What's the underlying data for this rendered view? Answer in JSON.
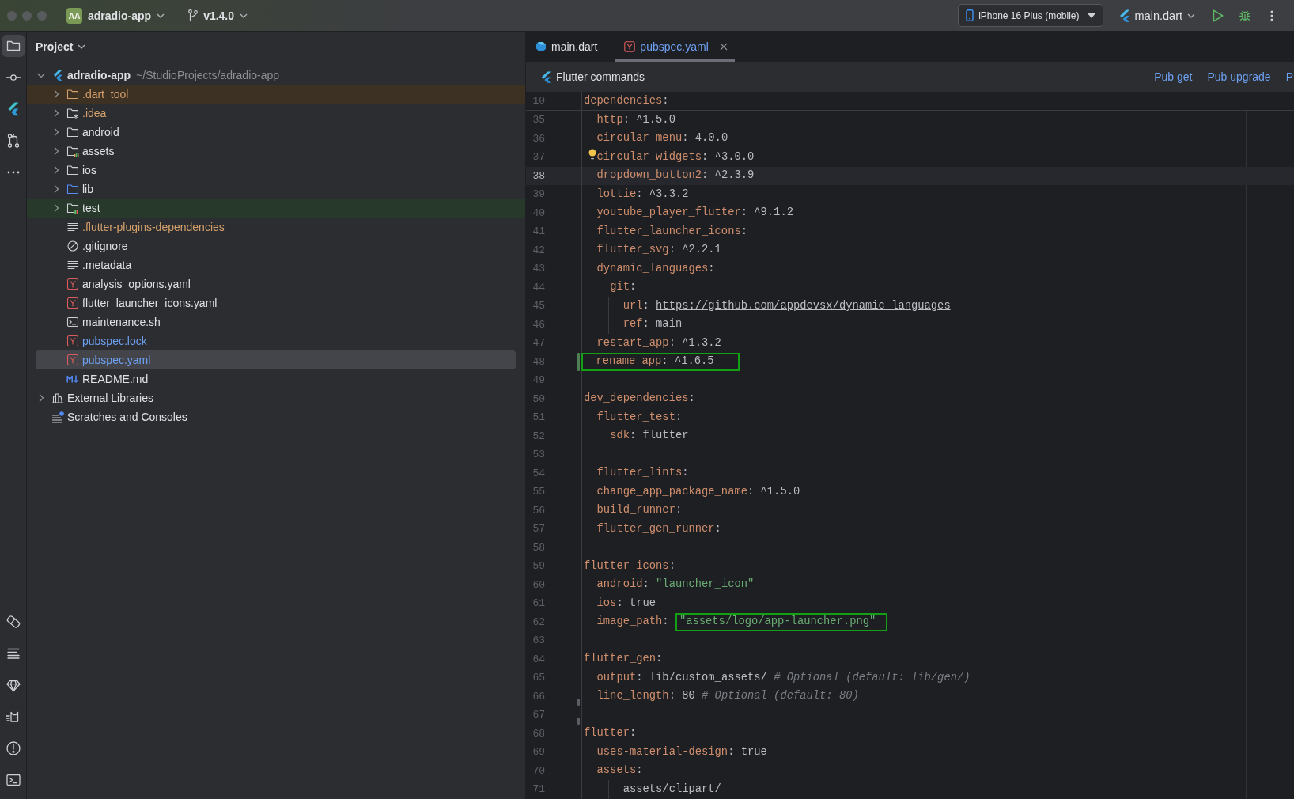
{
  "window": {
    "project_badge": "AA",
    "project": "adradio-app",
    "branch": "v1.4.0",
    "device": "iPhone 16 Plus (mobile)",
    "run_config": "main.dart"
  },
  "tool_strip": {
    "top": [
      {
        "kind": "project",
        "selected": true
      },
      {
        "kind": "commit",
        "selected": false
      },
      {
        "kind": "flutter",
        "selected": false
      },
      {
        "kind": "pull-requests",
        "selected": false
      },
      {
        "kind": "more",
        "selected": false
      }
    ],
    "bottom": [
      {
        "kind": "eraser",
        "selected": false
      },
      {
        "kind": "structure",
        "selected": false
      },
      {
        "kind": "gem",
        "selected": false
      },
      {
        "kind": "cat",
        "selected": false
      },
      {
        "kind": "problems",
        "selected": false
      },
      {
        "kind": "terminal",
        "selected": false
      }
    ]
  },
  "project_panel": {
    "title": "Project",
    "tree": [
      {
        "name": "adradio-app",
        "path": "~/StudioProjects/adradio-app",
        "kind": "project",
        "color": "#dfe1e5",
        "expanded": true,
        "selected": false,
        "children": [
          {
            "name": ".dart_tool",
            "kind": "excluded-folder",
            "color": "#d5a06b",
            "expanded": false,
            "selected": false
          },
          {
            "name": ".idea",
            "kind": "config-folder",
            "color": "#d5a06b",
            "expanded": false,
            "selected": false
          },
          {
            "name": "android",
            "kind": "folder",
            "color": "#dfe1e5",
            "expanded": false,
            "selected": false
          },
          {
            "name": "assets",
            "kind": "resource-folder",
            "color": "#dfe1e5",
            "expanded": false,
            "selected": false
          },
          {
            "name": "ios",
            "kind": "folder",
            "color": "#dfe1e5",
            "expanded": false,
            "selected": false
          },
          {
            "name": "lib",
            "kind": "source-folder",
            "color": "#dfe1e5",
            "expanded": false,
            "selected": false
          },
          {
            "name": "test",
            "kind": "test-folder",
            "color": "#dfe1e5",
            "expanded": false,
            "selected": false
          },
          {
            "name": ".flutter-plugins-dependencies",
            "kind": "text-file",
            "color": "#d5a06b",
            "selected": false
          },
          {
            "name": ".gitignore",
            "kind": "ignore-file",
            "color": "#dfe1e5",
            "selected": false
          },
          {
            "name": ".metadata",
            "kind": "text-file",
            "color": "#dfe1e5",
            "selected": false
          },
          {
            "name": "analysis_options.yaml",
            "kind": "yaml-file",
            "color": "#dfe1e5",
            "selected": false
          },
          {
            "name": "flutter_launcher_icons.yaml",
            "kind": "yaml-file",
            "color": "#dfe1e5",
            "selected": false
          },
          {
            "name": "maintenance.sh",
            "kind": "script-file",
            "color": "#dfe1e5",
            "selected": false
          },
          {
            "name": "pubspec.lock",
            "kind": "yaml-file",
            "color": "#6ea0f2",
            "selected": false
          },
          {
            "name": "pubspec.yaml",
            "kind": "yaml-file",
            "color": "#6ea0f2",
            "selected": true
          },
          {
            "name": "README.md",
            "kind": "markdown-file",
            "color": "#dfe1e5",
            "selected": false
          }
        ]
      },
      {
        "name": "External Libraries",
        "kind": "libraries",
        "color": "#dfe1e5",
        "expanded": false,
        "selected": false
      },
      {
        "name": "Scratches and Consoles",
        "kind": "scratches",
        "color": "#dfe1e5",
        "selected": false
      }
    ]
  },
  "editor": {
    "tabs": [
      {
        "label": "main.dart",
        "kind": "dart",
        "color": "#dfe1e5",
        "selected": false,
        "closable": false
      },
      {
        "label": "pubspec.yaml",
        "kind": "yaml",
        "color": "#6ea0f2",
        "selected": true,
        "closable": true
      }
    ],
    "commands": {
      "title": "Flutter commands",
      "actions": [
        "Pub get",
        "Pub upgrade",
        "P"
      ]
    },
    "sticky_line": {
      "number": "10",
      "segments": [
        {
          "kind": "key",
          "text": "dependencies"
        },
        {
          "kind": "plain",
          "text": ":"
        }
      ]
    },
    "lines": [
      {
        "number": "35",
        "kind": "plain",
        "segments": [
          {
            "kind": "key",
            "text": "  http"
          },
          {
            "kind": "plain",
            "text": ": ^1.5.0"
          }
        ]
      },
      {
        "number": "36",
        "kind": "plain",
        "segments": [
          {
            "kind": "key",
            "text": "  circular_menu"
          },
          {
            "kind": "plain",
            "text": ": 4.0.0"
          }
        ]
      },
      {
        "number": "37",
        "kind": "hint",
        "segments": [
          {
            "kind": "key",
            "text": "  circular_widgets"
          },
          {
            "kind": "plain",
            "text": ": ^3.0.0"
          }
        ]
      },
      {
        "number": "38",
        "kind": "current",
        "segments": [
          {
            "kind": "key",
            "text": "  dropdown_button2"
          },
          {
            "kind": "plain",
            "text": ": ^2.3.9"
          }
        ]
      },
      {
        "number": "39",
        "kind": "plain",
        "segments": [
          {
            "kind": "key",
            "text": "  lottie"
          },
          {
            "kind": "plain",
            "text": ": ^3.3.2"
          }
        ]
      },
      {
        "number": "40",
        "kind": "plain",
        "segments": [
          {
            "kind": "key",
            "text": "  youtube_player_flutter"
          },
          {
            "kind": "plain",
            "text": ": ^9.1.2"
          }
        ]
      },
      {
        "number": "41",
        "kind": "plain",
        "segments": [
          {
            "kind": "key",
            "text": "  flutter_launcher_icons"
          },
          {
            "kind": "plain",
            "text": ":"
          }
        ]
      },
      {
        "number": "42",
        "kind": "plain",
        "segments": [
          {
            "kind": "key",
            "text": "  flutter_svg"
          },
          {
            "kind": "plain",
            "text": ": ^2.2.1"
          }
        ]
      },
      {
        "number": "43",
        "kind": "plain",
        "segments": [
          {
            "kind": "key",
            "text": "  dynamic_languages"
          },
          {
            "kind": "plain",
            "text": ":"
          }
        ]
      },
      {
        "number": "44",
        "kind": "plain",
        "segments": [
          {
            "kind": "key",
            "text": "    git"
          },
          {
            "kind": "plain",
            "text": ":"
          }
        ]
      },
      {
        "number": "45",
        "kind": "plain",
        "segments": [
          {
            "kind": "key",
            "text": "      url"
          },
          {
            "kind": "plain",
            "text": ": "
          },
          {
            "kind": "url",
            "text": "https://github.com/appdevsx/dynamic_languages"
          }
        ]
      },
      {
        "number": "46",
        "kind": "plain",
        "segments": [
          {
            "kind": "key",
            "text": "      ref"
          },
          {
            "kind": "plain",
            "text": ": main"
          }
        ]
      },
      {
        "number": "47",
        "kind": "plain",
        "segments": [
          {
            "kind": "key",
            "text": "  restart_app"
          },
          {
            "kind": "plain",
            "text": ": ^1.3.2"
          }
        ]
      },
      {
        "number": "48",
        "kind": "framed",
        "marker": {
          "kind": "change"
        },
        "segments": [
          {
            "kind": "key",
            "text": "  rename_app"
          },
          {
            "kind": "plain",
            "text": ": ^1.6.5"
          }
        ]
      },
      {
        "number": "49",
        "kind": "plain"
      },
      {
        "number": "50",
        "kind": "plain",
        "segments": [
          {
            "kind": "key",
            "text": "dev_dependencies"
          },
          {
            "kind": "plain",
            "text": ":"
          }
        ]
      },
      {
        "number": "51",
        "kind": "plain",
        "segments": [
          {
            "kind": "key",
            "text": "  flutter_test"
          },
          {
            "kind": "plain",
            "text": ":"
          }
        ]
      },
      {
        "number": "52",
        "kind": "plain",
        "segments": [
          {
            "kind": "key",
            "text": "    sdk"
          },
          {
            "kind": "plain",
            "text": ": flutter"
          }
        ]
      },
      {
        "number": "53",
        "kind": "plain"
      },
      {
        "number": "54",
        "kind": "plain",
        "segments": [
          {
            "kind": "key",
            "text": "  flutter_lints"
          },
          {
            "kind": "plain",
            "text": ":"
          }
        ]
      },
      {
        "number": "55",
        "kind": "plain",
        "segments": [
          {
            "kind": "key",
            "text": "  change_app_package_name"
          },
          {
            "kind": "plain",
            "text": ": ^1.5.0"
          }
        ]
      },
      {
        "number": "56",
        "kind": "plain",
        "segments": [
          {
            "kind": "key",
            "text": "  build_runner"
          },
          {
            "kind": "plain",
            "text": ":"
          }
        ]
      },
      {
        "number": "57",
        "kind": "plain",
        "segments": [
          {
            "kind": "key",
            "text": "  flutter_gen_runner"
          },
          {
            "kind": "plain",
            "text": ":"
          }
        ]
      },
      {
        "number": "58",
        "kind": "plain"
      },
      {
        "number": "59",
        "kind": "plain",
        "segments": [
          {
            "kind": "key",
            "text": "flutter_icons"
          },
          {
            "kind": "plain",
            "text": ":"
          }
        ]
      },
      {
        "number": "60",
        "kind": "plain",
        "segments": [
          {
            "kind": "key",
            "text": "  android"
          },
          {
            "kind": "plain",
            "text": ": "
          },
          {
            "kind": "string",
            "text": "\"launcher_icon\""
          }
        ]
      },
      {
        "number": "61",
        "kind": "plain",
        "segments": [
          {
            "kind": "key",
            "text": "  ios"
          },
          {
            "kind": "plain",
            "text": ": true"
          }
        ]
      },
      {
        "number": "62",
        "kind": "plain",
        "segments": [
          {
            "kind": "key",
            "text": "  image_path"
          },
          {
            "kind": "plain",
            "text": ": "
          },
          {
            "kind": "framed-string",
            "text": "\"assets/logo/app-launcher.png\""
          }
        ]
      },
      {
        "number": "63",
        "kind": "plain"
      },
      {
        "number": "64",
        "kind": "plain",
        "segments": [
          {
            "kind": "key",
            "text": "flutter_gen"
          },
          {
            "kind": "plain",
            "text": ":"
          }
        ]
      },
      {
        "number": "65",
        "kind": "plain",
        "segments": [
          {
            "kind": "key",
            "text": "  output"
          },
          {
            "kind": "plain",
            "text": ": lib/custom_assets/ "
          },
          {
            "kind": "comment",
            "text": "# Optional (default: lib/gen/)"
          }
        ]
      },
      {
        "number": "66",
        "kind": "plain",
        "marker": {
          "kind": "stub"
        },
        "segments": [
          {
            "kind": "key",
            "text": "  line_length"
          },
          {
            "kind": "plain",
            "text": ": 80 "
          },
          {
            "kind": "comment",
            "text": "# Optional (default: 80)"
          }
        ]
      },
      {
        "number": "67",
        "kind": "plain",
        "marker": {
          "kind": "stub"
        }
      },
      {
        "number": "68",
        "kind": "plain",
        "segments": [
          {
            "kind": "key",
            "text": "flutter"
          },
          {
            "kind": "plain",
            "text": ":"
          }
        ]
      },
      {
        "number": "69",
        "kind": "plain",
        "segments": [
          {
            "kind": "key",
            "text": "  uses-material-design"
          },
          {
            "kind": "plain",
            "text": ": true"
          }
        ]
      },
      {
        "number": "70",
        "kind": "plain",
        "segments": [
          {
            "kind": "key",
            "text": "  assets"
          },
          {
            "kind": "plain",
            "text": ":"
          }
        ]
      },
      {
        "number": "71",
        "kind": "plain",
        "segments": [
          {
            "kind": "plain",
            "text": "      assets/clipart/"
          }
        ]
      }
    ]
  }
}
